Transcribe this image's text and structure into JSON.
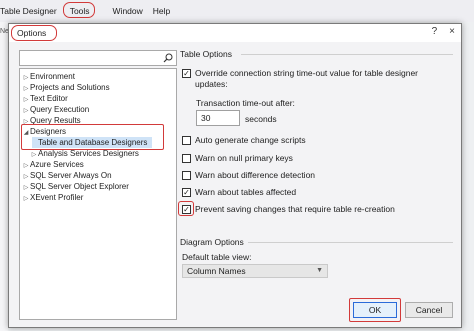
{
  "menubar": {
    "items": [
      "Table Designer",
      "Tools",
      "Window",
      "Help"
    ],
    "partial_below": "New"
  },
  "dialog": {
    "title": "Options",
    "help_glyph": "?",
    "close_glyph": "×"
  },
  "search": {
    "placeholder": ""
  },
  "tree": {
    "items": [
      {
        "label": "Environment",
        "arrow": "▷",
        "selected": false
      },
      {
        "label": "Projects and Solutions",
        "arrow": "▷",
        "selected": false
      },
      {
        "label": "Text Editor",
        "arrow": "▷",
        "selected": false
      },
      {
        "label": "Query Execution",
        "arrow": "▷",
        "selected": false
      },
      {
        "label": "Query Results",
        "arrow": "▷",
        "selected": false
      },
      {
        "label": "Designers",
        "arrow": "◢",
        "selected": false
      },
      {
        "label": "Table and Database Designers",
        "arrow": "",
        "selected": true
      },
      {
        "label": "Analysis Services Designers",
        "arrow": "▷",
        "selected": false
      },
      {
        "label": "Azure Services",
        "arrow": "▷",
        "selected": false
      },
      {
        "label": "SQL Server Always On",
        "arrow": "▷",
        "selected": false
      },
      {
        "label": "SQL Server Object Explorer",
        "arrow": "▷",
        "selected": false
      },
      {
        "label": "XEvent Profiler",
        "arrow": "▷",
        "selected": false
      }
    ]
  },
  "table_options": {
    "header": "Table Options",
    "override_label": "Override connection string time-out value for table designer updates:",
    "override_checked": true,
    "timeout_label": "Transaction time-out after:",
    "timeout_value": "30",
    "timeout_unit": "seconds",
    "checkboxes": [
      {
        "label": "Auto generate change scripts",
        "checked": false
      },
      {
        "label": "Warn on null primary keys",
        "checked": false
      },
      {
        "label": "Warn about difference detection",
        "checked": false
      },
      {
        "label": "Warn about tables affected",
        "checked": true
      },
      {
        "label": "Prevent saving changes that require table re-creation",
        "checked": true
      }
    ]
  },
  "diagram_options": {
    "header": "Diagram Options",
    "default_view_label": "Default table view:",
    "default_view_value": "Column Names"
  },
  "buttons": {
    "ok": "OK",
    "cancel": "Cancel"
  },
  "colors": {
    "highlight": "#d23a3a",
    "selection": "#cfe3f7",
    "ok_border": "#2b6cd9"
  }
}
